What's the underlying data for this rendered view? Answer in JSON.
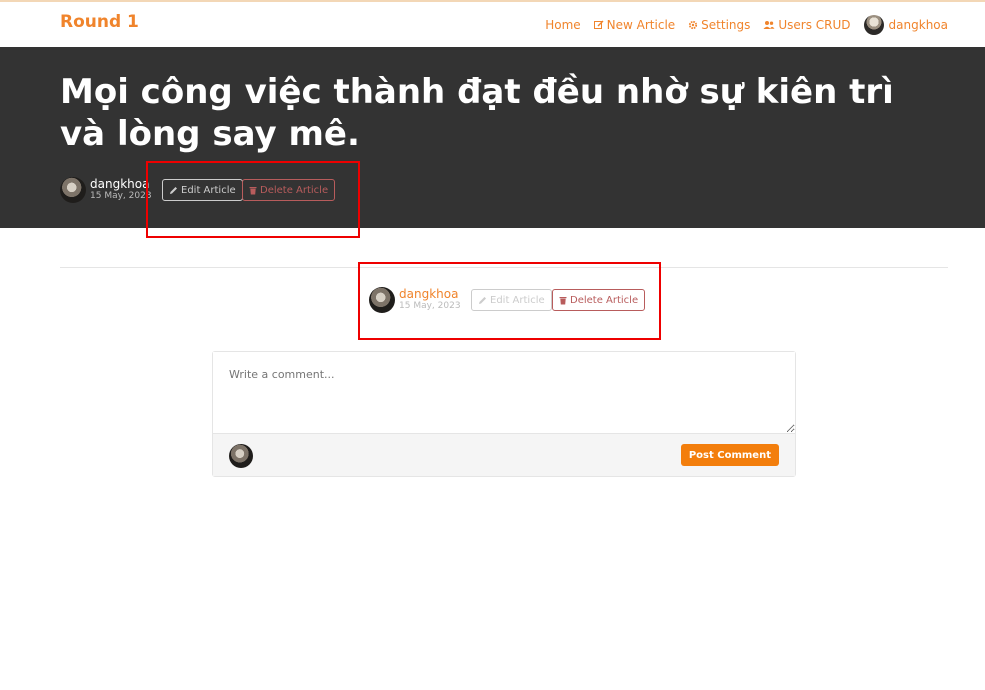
{
  "nav": {
    "brand": "Round 1",
    "items": [
      {
        "label": "Home",
        "icon": "none"
      },
      {
        "label": "New Article",
        "icon": "edit-icon"
      },
      {
        "label": "Settings",
        "icon": "gear-icon"
      },
      {
        "label": "Users CRUD",
        "icon": "users-icon"
      }
    ],
    "user": "dangkhoa"
  },
  "article": {
    "title": "Mọi công việc thành đạt đều nhờ sự kiên trì và lòng say mê.",
    "author": "dangkhoa",
    "date": "15 May, 2023",
    "edit_label": "Edit Article",
    "delete_label": "Delete Article"
  },
  "comment": {
    "placeholder": "Write a comment...",
    "post_label": "Post Comment"
  },
  "colors": {
    "accent": "#f0842c",
    "banner_bg": "#333333",
    "danger": "#b85c5c",
    "highlight_box": "#ee0000"
  }
}
